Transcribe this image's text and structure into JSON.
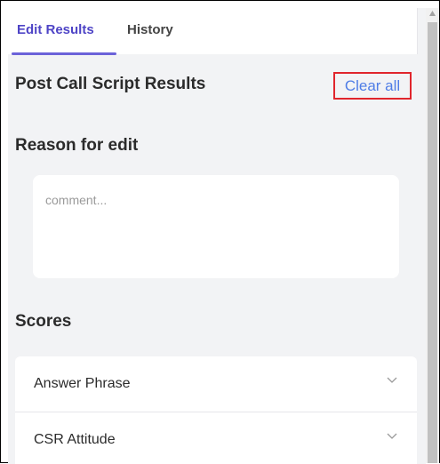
{
  "tabs": [
    {
      "label": "Edit Results",
      "active": true
    },
    {
      "label": "History",
      "active": false
    }
  ],
  "results": {
    "title": "Post Call Script Results",
    "clear_all_label": "Clear all"
  },
  "reason": {
    "title": "Reason for edit",
    "placeholder": "comment..."
  },
  "scores": {
    "title": "Scores",
    "items": [
      {
        "label": "Answer Phrase",
        "icon": "chevron-down-icon"
      },
      {
        "label": "CSR Attitude",
        "icon": "chevron-down-icon"
      }
    ]
  },
  "colors": {
    "accent": "#4e44c6",
    "link": "#4f7de6",
    "highlight_border": "#e0252c",
    "panel_bg": "#f2f3f5"
  }
}
